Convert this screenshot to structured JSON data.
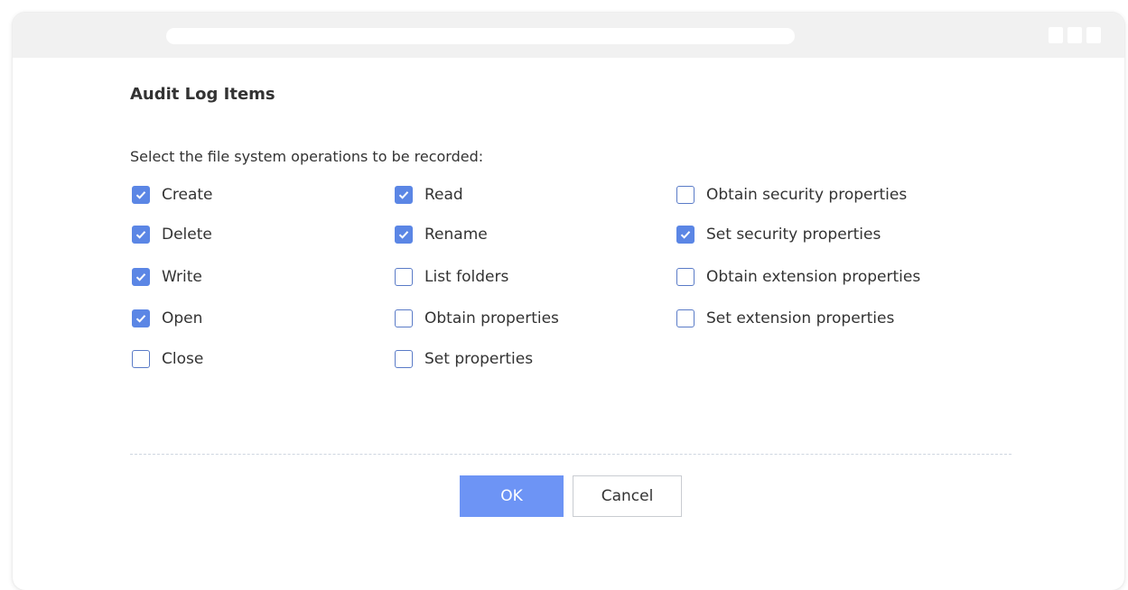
{
  "dialog": {
    "title": "Audit Log Items",
    "instruction": "Select the file system operations to be recorded:"
  },
  "options": {
    "col1": [
      {
        "label": "Create",
        "checked": true
      },
      {
        "label": "Delete",
        "checked": true
      },
      {
        "label": "Write",
        "checked": true
      },
      {
        "label": "Open",
        "checked": true
      },
      {
        "label": "Close",
        "checked": false
      }
    ],
    "col2": [
      {
        "label": "Read",
        "checked": true
      },
      {
        "label": "Rename",
        "checked": true
      },
      {
        "label": "List folders",
        "checked": false
      },
      {
        "label": "Obtain properties",
        "checked": false
      },
      {
        "label": "Set properties",
        "checked": false
      }
    ],
    "col3": [
      {
        "label": "Obtain security properties",
        "checked": false
      },
      {
        "label": "Set security properties",
        "checked": true
      },
      {
        "label": "Obtain extension properties",
        "checked": false
      },
      {
        "label": "Set extension properties",
        "checked": false
      }
    ]
  },
  "buttons": {
    "ok": "OK",
    "cancel": "Cancel"
  },
  "colors": {
    "accent": "#6d94f5",
    "checkbox_checked": "#5b86e5",
    "checkbox_border": "#5a7bc7",
    "text": "#333333",
    "titlebar": "#f1f1f1"
  },
  "icons": {
    "checkmark": "checkmark-icon"
  }
}
